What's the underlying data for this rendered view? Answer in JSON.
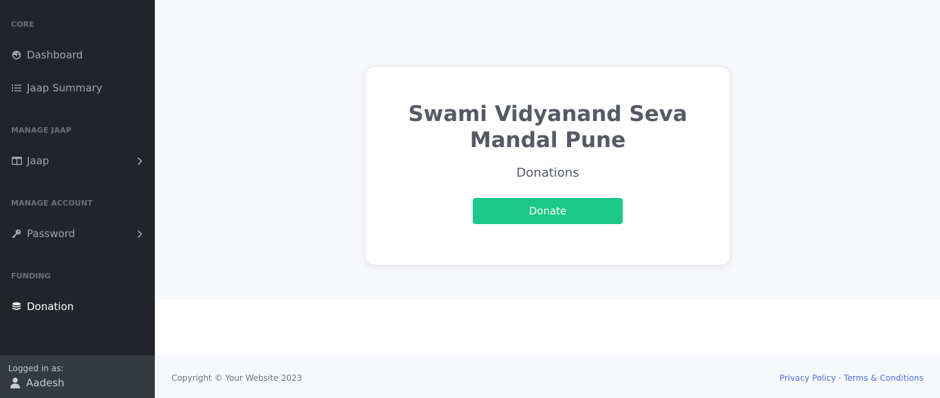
{
  "sidebar": {
    "sections": {
      "core": "CORE",
      "manage_jaap": "MANAGE JAAP",
      "manage_account": "MANAGE ACCOUNT",
      "funding": "FUNDING"
    },
    "items": {
      "dashboard": "Dashboard",
      "jaap_summary": "Jaap Summary",
      "jaap": "Jaap",
      "password": "Password",
      "donation": "Donation"
    },
    "footer": {
      "logged_in_label": "Logged in as:",
      "username": "Aadesh"
    }
  },
  "card": {
    "title": "Swami Vidyanand Seva Mandal Pune",
    "subtitle": "Donations",
    "button_label": "Donate",
    "button_color": "#1cc88a"
  },
  "footer": {
    "copyright": "Copyright © Your Website 2023",
    "privacy": "Privacy Policy",
    "separator": "·",
    "terms": "Terms & Conditions"
  },
  "colors": {
    "sidebar_bg": "#212529",
    "sidebar_footer_bg": "#343a40",
    "content_bg": "#f7f8fb",
    "link": "#4e73df"
  },
  "icons": {
    "dashboard": "tachometer-icon",
    "jaap_summary": "list-icon",
    "jaap": "columns-icon",
    "password": "key-icon",
    "donation": "coins-icon",
    "user": "user-icon",
    "chevron": "chevron-right-icon"
  }
}
